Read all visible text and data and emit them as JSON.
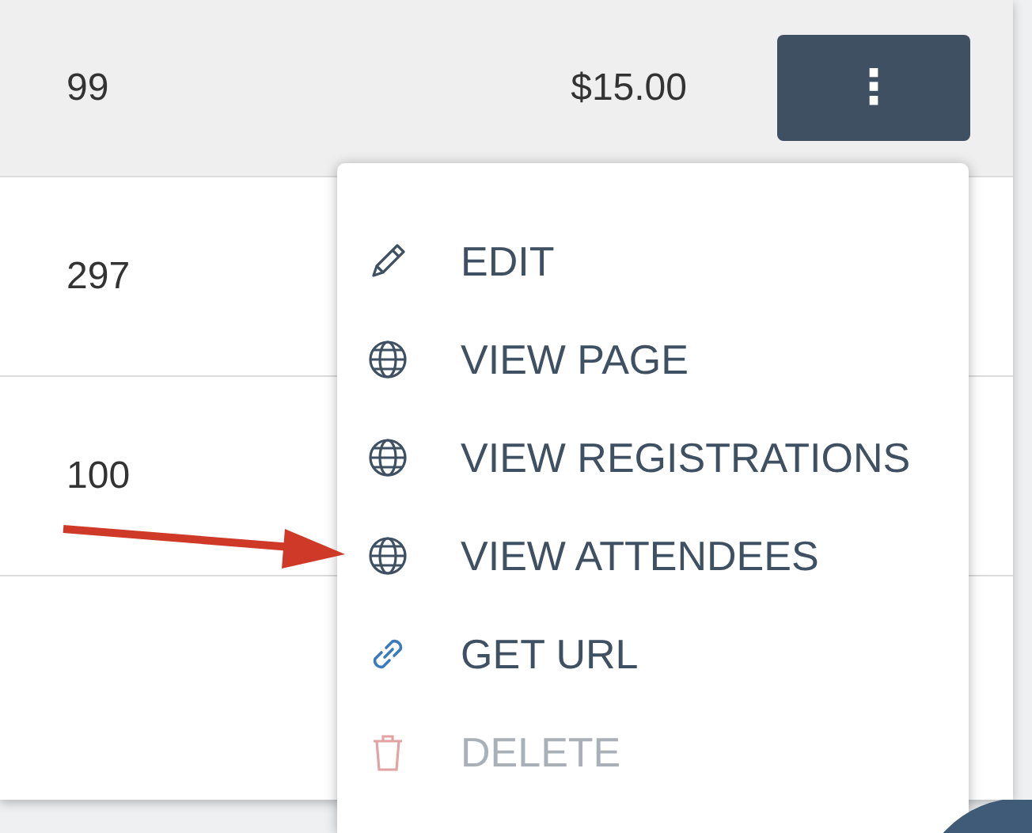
{
  "table": {
    "rows": [
      {
        "column_1": "99",
        "column_2": "$15.00",
        "highlighted": true,
        "menu_button": "⋮"
      },
      {
        "column_1": "297",
        "highlighted": false
      },
      {
        "column_1": "100",
        "highlighted": false
      }
    ]
  },
  "menu": {
    "items": [
      {
        "kind": "pencil",
        "label": "EDIT",
        "disabled": false
      },
      {
        "kind": "globe",
        "label": "VIEW PAGE",
        "disabled": false
      },
      {
        "kind": "globe",
        "label": "VIEW REGISTRATIONS",
        "disabled": false
      },
      {
        "kind": "globe",
        "label": "VIEW ATTENDEES",
        "disabled": false
      },
      {
        "kind": "link",
        "label": "GET URL",
        "disabled": false
      },
      {
        "kind": "trash",
        "label": "DELETE",
        "disabled": true
      }
    ]
  }
}
